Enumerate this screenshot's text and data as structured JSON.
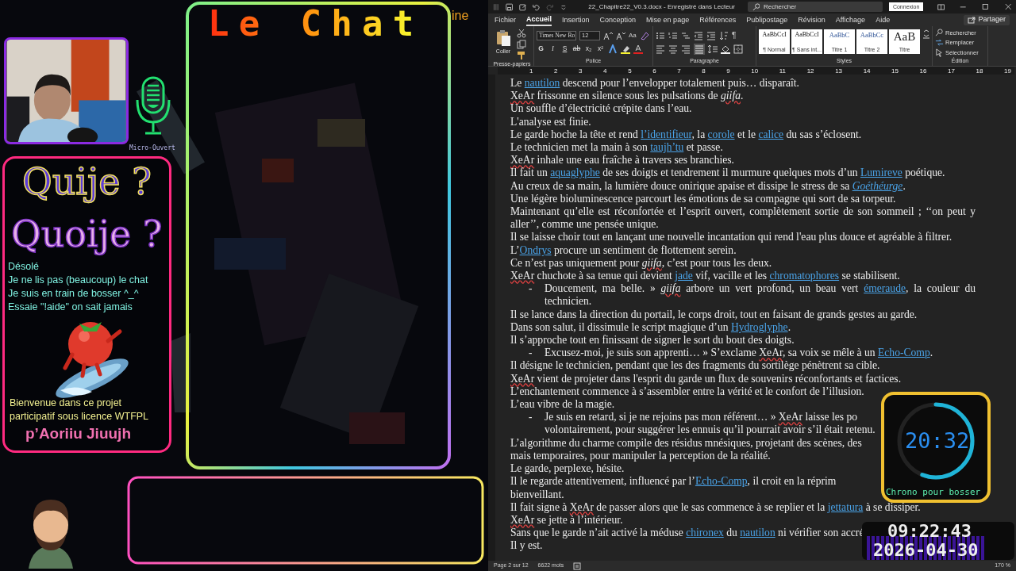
{
  "overlay": {
    "chat_title": "Le Chat",
    "top_fragment": "ine",
    "mic_label": "Micro-Ouvert",
    "card": {
      "title_lines": [
        "Quije ?",
        "Quoije ?"
      ],
      "messages": [
        "Désolé",
        "Je ne lis pas (beaucoup) le chat",
        "Je suis en train de bosser ^_^",
        "Essaie \"!aide\" on sait jamais"
      ],
      "welcome": "Bienvenue dans ce projet participatif sous licence WTFPL",
      "signature": "p’Aoriiu Jiuujh"
    },
    "timer": {
      "time": "20:32",
      "label": "Chrono pour bosser",
      "level": 0.56
    },
    "clock": {
      "time": "09:22:43",
      "date": "2026-04-30"
    }
  },
  "word": {
    "title": "22_Chapitre22_V0.3.docx - Enregistré dans Lecteur",
    "search_placeholder": "Rechercher",
    "signin": "Connexion",
    "share": "Partager",
    "tabs": [
      {
        "label": "Fichier",
        "selected": false
      },
      {
        "label": "Accueil",
        "selected": true
      },
      {
        "label": "Insertion",
        "selected": false
      },
      {
        "label": "Conception",
        "selected": false
      },
      {
        "label": "Mise en page",
        "selected": false
      },
      {
        "label": "Références",
        "selected": false
      },
      {
        "label": "Publipostage",
        "selected": false
      },
      {
        "label": "Révision",
        "selected": false
      },
      {
        "label": "Affichage",
        "selected": false
      },
      {
        "label": "Aide",
        "selected": false
      }
    ],
    "ribbon": {
      "clipboard": {
        "group": "Presse-papiers",
        "paste": "Coller"
      },
      "font": {
        "group": "Police",
        "family": "Times New Ro",
        "size": "12",
        "case_button": "Aa",
        "format_buttons": [
          "G",
          "I",
          "S",
          "ab",
          "x₂",
          "x²"
        ]
      },
      "paragraph": {
        "group": "Paragraphe",
        "pilcrow": "¶"
      },
      "styles": {
        "group": "Styles",
        "items": [
          {
            "preview": "AaBbCcI",
            "name": "¶ Normal"
          },
          {
            "preview": "AaBbCcI",
            "name": "¶ Sans int..."
          },
          {
            "preview": "AaBbC",
            "name": "Titre 1"
          },
          {
            "preview": "AaBbCc",
            "name": "Titre 2"
          },
          {
            "preview": "AaB",
            "name": "Titre"
          }
        ]
      },
      "editing": {
        "group": "Édition",
        "items": [
          "Rechercher",
          "Remplacer",
          "Sélectionner"
        ]
      }
    },
    "ruler": [
      "1",
      "2",
      "3",
      "4",
      "5",
      "6",
      "7",
      "8",
      "9",
      "10",
      "11",
      "12",
      "13",
      "14",
      "15",
      "16",
      "17",
      "18",
      "19"
    ],
    "paragraphs": [
      {
        "segments": [
          {
            "text": "Le ",
            "kind": "plain"
          },
          {
            "text": "nautilon",
            "kind": "link"
          },
          {
            "text": " descend pour l’envelopper totalement puis… disparaît.",
            "kind": "plain"
          }
        ]
      },
      {
        "segments": [
          {
            "text": "XeAr",
            "kind": "spell"
          },
          {
            "text": " frissonne en silence sous les pulsations de ",
            "kind": "plain"
          },
          {
            "text": "giifa",
            "kind": "italic"
          },
          {
            "text": ".",
            "kind": "plain"
          }
        ]
      },
      {
        "segments": [
          {
            "text": "Un souffle d’électricité crépite dans l’eau.",
            "kind": "plain"
          }
        ]
      },
      {
        "segments": [
          {
            "text": "L'analyse est finie.",
            "kind": "plain"
          }
        ]
      },
      {
        "segments": [
          {
            "text": "Le garde hoche la tête et rend ",
            "kind": "plain"
          },
          {
            "text": "l’identifieur",
            "kind": "link"
          },
          {
            "text": ", la ",
            "kind": "plain"
          },
          {
            "text": "corole",
            "kind": "link"
          },
          {
            "text": " et le ",
            "kind": "plain"
          },
          {
            "text": "calice",
            "kind": "link"
          },
          {
            "text": " du sas s’éclosent.",
            "kind": "plain"
          }
        ]
      },
      {
        "segments": [
          {
            "text": "Le technicien met la main à son ",
            "kind": "plain"
          },
          {
            "text": "taujh’tu",
            "kind": "link"
          },
          {
            "text": " et passe.",
            "kind": "plain"
          }
        ]
      },
      {
        "segments": [
          {
            "text": "XeAr",
            "kind": "spell"
          },
          {
            "text": " inhale une eau fraîche à travers ses branchies.",
            "kind": "plain"
          }
        ]
      },
      {
        "segments": [
          {
            "text": "Il fait un ",
            "kind": "plain"
          },
          {
            "text": "aquaglyphe",
            "kind": "link"
          },
          {
            "text": " de ses doigts et tendrement il murmure quelques mots d’un ",
            "kind": "plain"
          },
          {
            "text": "Lumireve",
            "kind": "link"
          },
          {
            "text": " poétique.",
            "kind": "plain"
          }
        ]
      },
      {
        "segments": [
          {
            "text": "Au creux de sa main, la lumière douce onirique apaise et dissipe le stress de sa ",
            "kind": "plain"
          },
          {
            "text": "Goéthéurge",
            "kind": "italic_link"
          },
          {
            "text": ".",
            "kind": "plain"
          }
        ]
      },
      {
        "segments": [
          {
            "text": "Une légère bioluminescence parcourt les émotions de sa compagne qui sort de sa torpeur.",
            "kind": "plain"
          }
        ]
      },
      {
        "segments": [
          {
            "text": "Maintenant qu’elle est réconfortée et l’esprit ouvert, complètement sortie de son sommeil ; ‘‘on peut y aller’’, comme une pensée unique.",
            "kind": "plain"
          }
        ]
      },
      {
        "segments": [
          {
            "text": "Il se laisse choir tout en lançant une nouvelle incantation qui rend l'eau plus douce et agréable à filtrer.",
            "kind": "plain"
          }
        ]
      },
      {
        "segments": [
          {
            "text": "L’",
            "kind": "plain"
          },
          {
            "text": "Ondrys",
            "kind": "link"
          },
          {
            "text": " procure un sentiment de flottement serein.",
            "kind": "plain"
          }
        ]
      },
      {
        "segments": [
          {
            "text": "Ce n’est pas uniquement pour ",
            "kind": "plain"
          },
          {
            "text": "giifa",
            "kind": "italic"
          },
          {
            "text": ", c’est pour tous les deux.",
            "kind": "plain"
          }
        ]
      },
      {
        "segments": [
          {
            "text": "XeAr",
            "kind": "spell"
          },
          {
            "text": " chuchote à sa tenue qui devient ",
            "kind": "plain"
          },
          {
            "text": "jade",
            "kind": "link"
          },
          {
            "text": " vif, vacille et les ",
            "kind": "plain"
          },
          {
            "text": "chromatophores",
            "kind": "link"
          },
          {
            "text": " se stabilisent.",
            "kind": "plain"
          }
        ]
      },
      {
        "bullet": "-",
        "segments": [
          {
            "text": "Doucement, ma belle. » ",
            "kind": "plain"
          },
          {
            "text": "giifa",
            "kind": "italic"
          },
          {
            "text": " arbore un vert profond, un beau vert ",
            "kind": "plain"
          },
          {
            "text": "émeraude",
            "kind": "link"
          },
          {
            "text": ", la couleur du technicien.",
            "kind": "plain"
          }
        ]
      },
      {
        "segments": [
          {
            "text": "Il se lance dans la direction du portail, le corps droit, tout en faisant de grands gestes au garde.",
            "kind": "plain"
          }
        ]
      },
      {
        "segments": [
          {
            "text": "Dans son salut, il dissimule le script magique d’un ",
            "kind": "plain"
          },
          {
            "text": "Hydroglyphe",
            "kind": "link"
          },
          {
            "text": ".",
            "kind": "plain"
          }
        ]
      },
      {
        "segments": [
          {
            "text": "Il s’approche tout en finissant de signer le sort du bout des doigts.",
            "kind": "plain"
          }
        ]
      },
      {
        "bullet": "-",
        "segments": [
          {
            "text": "Excusez-moi, je suis son apprenti… » S’exclame ",
            "kind": "plain"
          },
          {
            "text": "XeAr",
            "kind": "spell"
          },
          {
            "text": ", sa voix se mêle à un ",
            "kind": "plain"
          },
          {
            "text": "Echo-Comp",
            "kind": "link"
          },
          {
            "text": ".",
            "kind": "plain"
          }
        ]
      },
      {
        "segments": [
          {
            "text": "Il désigne le technicien, pendant que les des fragments du sortilège pénètrent sa cible.",
            "kind": "plain"
          }
        ]
      },
      {
        "segments": [
          {
            "text": "XeAr",
            "kind": "spell"
          },
          {
            "text": " vient de projeter dans l'esprit du garde un flux de souvenirs réconfortants et factices.",
            "kind": "plain"
          }
        ]
      },
      {
        "segments": [
          {
            "text": "L’enchantement commence à s’assembler entre la vérité et le confort de l’illusion.",
            "kind": "plain"
          }
        ]
      },
      {
        "segments": [
          {
            "text": "L’eau vibre de la magie.",
            "kind": "plain"
          }
        ]
      },
      {
        "bullet": "-",
        "lines": [
          [
            {
              "text": "Je suis en retard, si je ne rejoins pas mon référent… » ",
              "kind": "plain"
            },
            {
              "text": "XeAr",
              "kind": "spell"
            },
            {
              "text": " laisse les po",
              "kind": "plain"
            }
          ],
          [
            {
              "text": "volontairement, pour suggérer les ennuis qu’il pourrait avoir s’il était retenu.",
              "kind": "plain"
            }
          ]
        ]
      },
      {
        "lines": [
          [
            {
              "text": "L’algorithme du charme compile des résidus mnésiques, projetant des scènes, des",
              "kind": "plain"
            }
          ],
          [
            {
              "text": "mais temporaires, pour manipuler la perception de la réalité.",
              "kind": "plain"
            }
          ]
        ]
      },
      {
        "segments": [
          {
            "text": "Le garde, perplexe, hésite.",
            "kind": "plain"
          }
        ]
      },
      {
        "lines": [
          [
            {
              "text": "Il le regarde attentivement, influencé par l’",
              "kind": "plain"
            },
            {
              "text": "Echo-Comp",
              "kind": "link"
            },
            {
              "text": ", il croit en la réprim",
              "kind": "plain"
            }
          ],
          [
            {
              "text": "bienveillant.",
              "kind": "plain"
            }
          ]
        ]
      },
      {
        "segments": [
          {
            "text": "Il fait signe à ",
            "kind": "plain"
          },
          {
            "text": "XeAr",
            "kind": "spell"
          },
          {
            "text": " de passer alors que le sas commence à se replier et la ",
            "kind": "plain"
          },
          {
            "text": "jettatura",
            "kind": "link"
          },
          {
            "text": " à se dissiper.",
            "kind": "plain"
          }
        ]
      },
      {
        "segments": [
          {
            "text": "XeAr",
            "kind": "spell"
          },
          {
            "text": " se jette à l’intérieur.",
            "kind": "plain"
          }
        ]
      },
      {
        "lines": [
          [
            {
              "text": "Sans que le garde n’ait activé la méduse ",
              "kind": "plain"
            },
            {
              "text": "chironex",
              "kind": "link"
            },
            {
              "text": " du ",
              "kind": "plain"
            },
            {
              "text": "nautilon",
              "kind": "link"
            },
            {
              "text": " ni vérifier son accré",
              "kind": "plain"
            }
          ]
        ]
      },
      {
        "segments": [
          {
            "text": "Il y est.",
            "kind": "plain"
          }
        ]
      }
    ],
    "status": {
      "page": "Page 2 sur 12",
      "words": "6622 mots",
      "zoom": "170 %"
    }
  }
}
